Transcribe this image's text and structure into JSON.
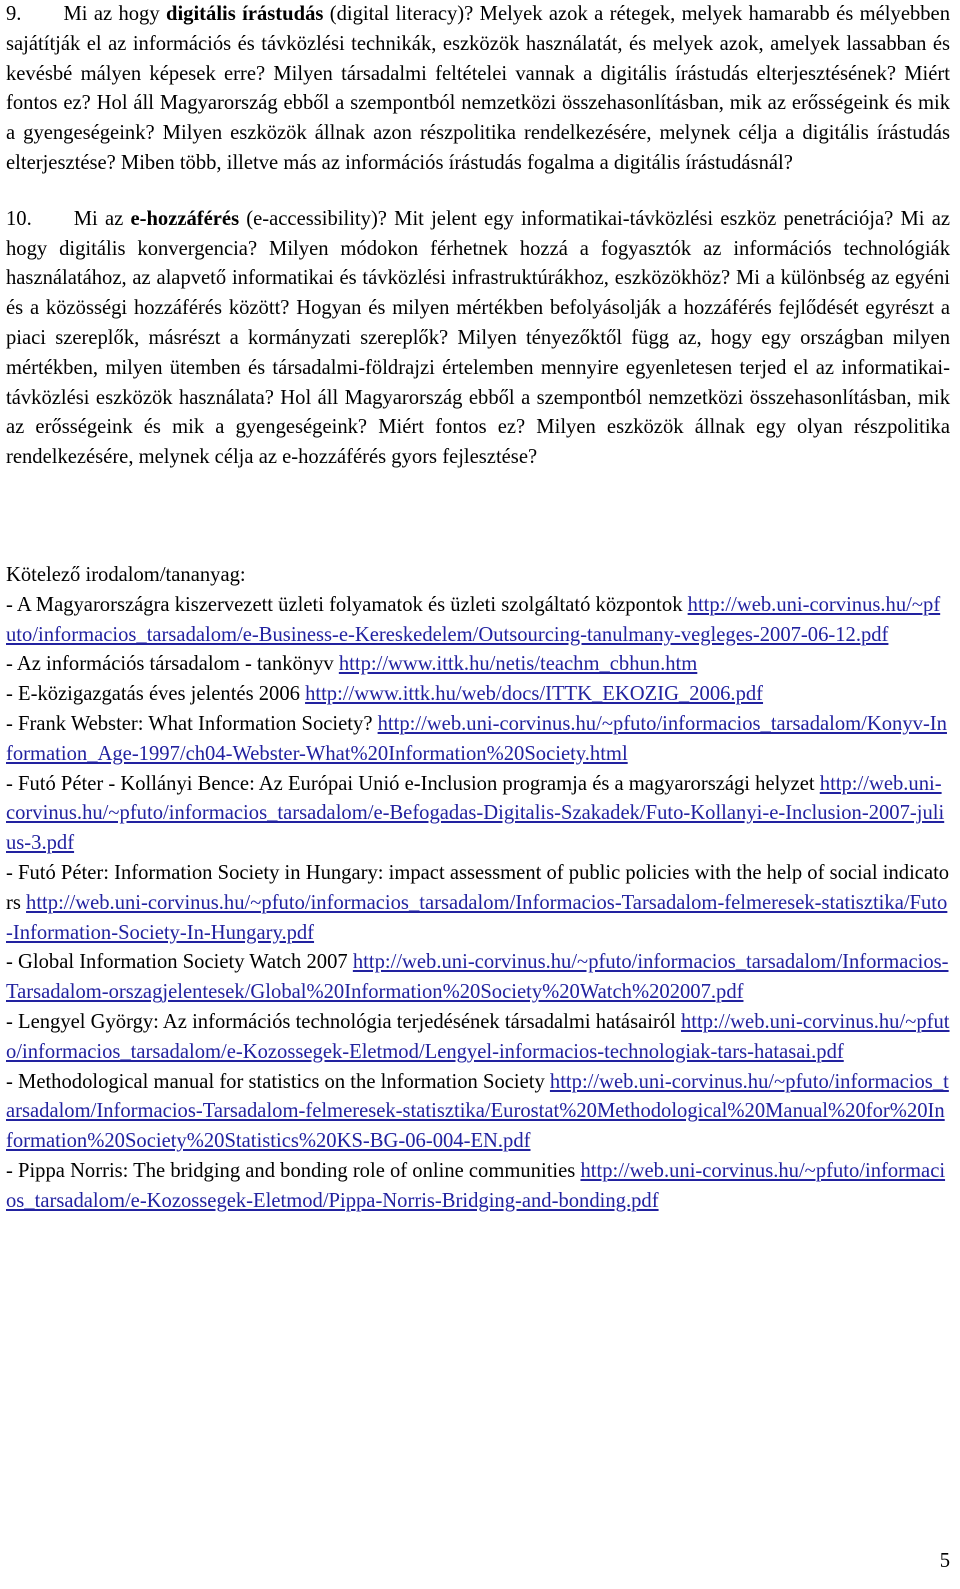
{
  "document": {
    "language": "hu",
    "page_number": "5",
    "link_color": "#2222a0",
    "text_color": "#000000",
    "background_color": "#ffffff"
  },
  "questions": [
    {
      "number": "9.",
      "lead_plain": "Mi az hogy ",
      "lead_bold": "digitális írástudás",
      "body": " (digital literacy)? Melyek azok a rétegek, melyek hamarabb és mélyebben sajátítják el az információs és távközlési technikák, eszközök használatát, és melyek azok, amelyek lassabban és kevésbé mályen képesek erre? Milyen társadalmi feltételei vannak a digitális írástudás elterjesztésének? Miért fontos ez? Hol áll Magyarország ebből a szempontból nemzetközi összehasonlításban, mik az erősségeink és mik a gyengeségeink? Milyen eszközök állnak azon részpolitika rendelkezésére, melynek célja a digitális írástudás elterjesztése? Miben több, illetve más az információs írástudás fogalma a digitális írástudásnál?"
    },
    {
      "number": "10.",
      "lead_plain": "Mi az ",
      "lead_bold": "e-hozzáférés",
      "body": " (e-accessibility)? Mit jelent egy informatikai-távközlési eszköz penetrációja? Mi az hogy digitális konvergencia? Milyen módokon férhetnek hozzá a fogyasztók az információs technológiák használatához, az alapvető informatikai és távközlési infrastruktúrákhoz, eszközökhöz? Mi a különbség az egyéni és a közösségi hozzáférés között? Hogyan és milyen mértékben befolyásolják  a hozzáférés fejlődését egyrészt a piaci szereplők, másrészt a kormányzati szereplők? Milyen tényezőktől függ az, hogy egy országban milyen mértékben, milyen ütemben és társadalmi-földrajzi értelemben mennyire egyenletesen terjed el az informatikai-távközlési eszközök használata? Hol áll Magyarország ebből a szempontból nemzetközi összehasonlításban, mik az erősségeink és mik a gyengeségeink? Miért fontos ez? Milyen eszközök állnak egy olyan részpolitika rendelkezésére, melynek célja az e-hozzáférés gyors fejlesztése?"
    }
  ],
  "bibliography": {
    "heading": "Kötelező irodalom/tananyag:",
    "items": [
      {
        "text_before": "- A Magyarországra kiszervezett üzleti folyamatok és üzleti szolgáltató központok ",
        "link": "http://web.uni-corvinus.hu/~pfuto/informacios_tarsadalom/e-Business-e-Kereskedelem/Outsourcing-tanulmany-vegleges-2007-06-12.pdf",
        "text_after": ""
      },
      {
        "text_before": "- Az információs társadalom  - tankönyv ",
        "link": "http://www.ittk.hu/netis/teachm_cbhun.htm",
        "text_after": ""
      },
      {
        "text_before": "- E-közigazgatás éves jelentés 2006 ",
        "link": "http://www.ittk.hu/web/docs/ITTK_EKOZIG_2006.pdf",
        "text_after": ""
      },
      {
        "text_before": "- Frank Webster: What Information Society? ",
        "link": "http://web.uni-corvinus.hu/~pfuto/informacios_tarsadalom/Konyv-Information_Age-1997/ch04-Webster-What%20Information%20Society.html",
        "text_after": ""
      },
      {
        "text_before": "- Futó Péter - Kollányi Bence: Az Európai Unió e-Inclusion programja és a magyarországi helyzet ",
        "link": "http://web.uni-corvinus.hu/~pfuto/informacios_tarsadalom/e-Befogadas-Digitalis-Szakadek/Futo-Kollanyi-e-Inclusion-2007-julius-3.pdf",
        "text_after": ""
      },
      {
        "text_before": "- Futó Péter: Information Society in Hungary: impact assessment of public policies with the help of social indicators ",
        "link": "http://web.uni-corvinus.hu/~pfuto/informacios_tarsadalom/Informacios-Tarsadalom-felmeresek-statisztika/Futo-Information-Society-In-Hungary.pdf",
        "text_after": ""
      },
      {
        "text_before": "- Global Information Society Watch 2007 ",
        "link": "http://web.uni-corvinus.hu/~pfuto/informacios_tarsadalom/Informacios-Tarsadalom-orszagjelentesek/Global%20Information%20Society%20Watch%202007.pdf",
        "text_after": ""
      },
      {
        "text_before": "- Lengyel György: Az információs technológia terjedésének társadalmi hatásairól ",
        "link": "http://web.uni-corvinus.hu/~pfuto/informacios_tarsadalom/e-Kozossegek-Eletmod/Lengyel-informacios-technologiak-tars-hatasai.pdf",
        "text_after": ""
      },
      {
        "text_before": "- Methodological manual for statistics on the lnformation Society ",
        "link": "http://web.uni-corvinus.hu/~pfuto/informacios_tarsadalom/Informacios-Tarsadalom-felmeresek-statisztika/Eurostat%20Methodological%20Manual%20for%20Information%20Society%20Statistics%20KS-BG-06-004-EN.pdf",
        "text_after": ""
      },
      {
        "text_before": "- Pippa Norris: The bridging and bonding role of online communities ",
        "link": "http://web.uni-corvinus.hu/~pfuto/informacios_tarsadalom/e-Kozossegek-Eletmod/Pippa-Norris-Bridging-and-bonding.pdf",
        "text_after": ""
      }
    ]
  }
}
